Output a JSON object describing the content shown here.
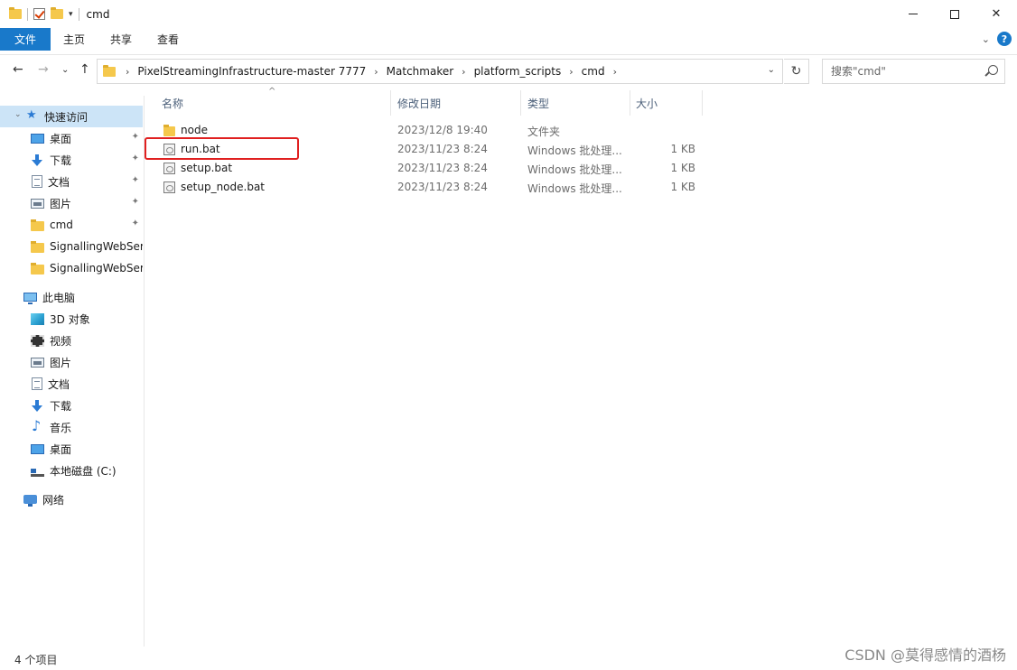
{
  "window": {
    "title": "cmd",
    "qa_dropdown": "▾",
    "close_glyph": "✕"
  },
  "ribbon": {
    "tabs": [
      "文件",
      "主页",
      "共享",
      "查看"
    ],
    "collapse_glyph": "⌄",
    "help_glyph": "?"
  },
  "nav": {
    "back": "←",
    "forward": "→",
    "recent": "⌄",
    "up": "↑",
    "breadcrumb": [
      "PixelStreamingInfrastructure-master 7777",
      "Matchmaker",
      "platform_scripts",
      "cmd"
    ],
    "separator": "›",
    "address_dropdown": "⌄",
    "refresh": "↻",
    "search_placeholder": "搜索\"cmd\""
  },
  "sidebar": {
    "items": [
      {
        "label": "快速访问",
        "icon": "star-icon",
        "pinned": false,
        "active": true
      },
      {
        "label": "桌面",
        "icon": "desktop-icon",
        "pinned": true
      },
      {
        "label": "下载",
        "icon": "download-icon",
        "pinned": true
      },
      {
        "label": "文档",
        "icon": "document-icon",
        "pinned": true
      },
      {
        "label": "图片",
        "icon": "picture-icon",
        "pinned": true
      },
      {
        "label": "cmd",
        "icon": "folder-icon",
        "pinned": true
      },
      {
        "label": "SignallingWebSer",
        "icon": "folder-icon",
        "pinned": false
      },
      {
        "label": "SignallingWebSer",
        "icon": "folder-icon",
        "pinned": false
      },
      {
        "label": "此电脑",
        "icon": "computer-icon",
        "pinned": false
      },
      {
        "label": "3D 对象",
        "icon": "3d-objects-icon",
        "pinned": false
      },
      {
        "label": "视频",
        "icon": "video-icon",
        "pinned": false
      },
      {
        "label": "图片",
        "icon": "picture-icon",
        "pinned": false
      },
      {
        "label": "文档",
        "icon": "document-icon",
        "pinned": false
      },
      {
        "label": "下载",
        "icon": "download-icon",
        "pinned": false
      },
      {
        "label": "音乐",
        "icon": "music-icon",
        "pinned": false
      },
      {
        "label": "桌面",
        "icon": "desktop-icon",
        "pinned": false
      },
      {
        "label": "本地磁盘 (C:)",
        "icon": "drive-icon",
        "pinned": false
      },
      {
        "label": "网络",
        "icon": "network-icon",
        "pinned": false
      }
    ],
    "pin_glyph": "📌"
  },
  "list": {
    "columns": [
      "名称",
      "修改日期",
      "类型",
      "大小"
    ],
    "sort_glyph": "^",
    "rows": [
      {
        "name": "node",
        "date": "2023/12/8 19:40",
        "type": "文件夹",
        "size": "",
        "icon": "folder"
      },
      {
        "name": "run.bat",
        "date": "2023/11/23 8:24",
        "type": "Windows 批处理...",
        "size": "1 KB",
        "icon": "bat"
      },
      {
        "name": "setup.bat",
        "date": "2023/11/23 8:24",
        "type": "Windows 批处理...",
        "size": "1 KB",
        "icon": "bat"
      },
      {
        "name": "setup_node.bat",
        "date": "2023/11/23 8:24",
        "type": "Windows 批处理...",
        "size": "1 KB",
        "icon": "bat"
      }
    ]
  },
  "status": {
    "count": "4 个项目",
    "watermark": "CSDN @莫得感情的酒杨"
  },
  "colors": {
    "accent": "#1979ca",
    "selection": "#cce4f7",
    "highlight_box": "#e02020"
  }
}
